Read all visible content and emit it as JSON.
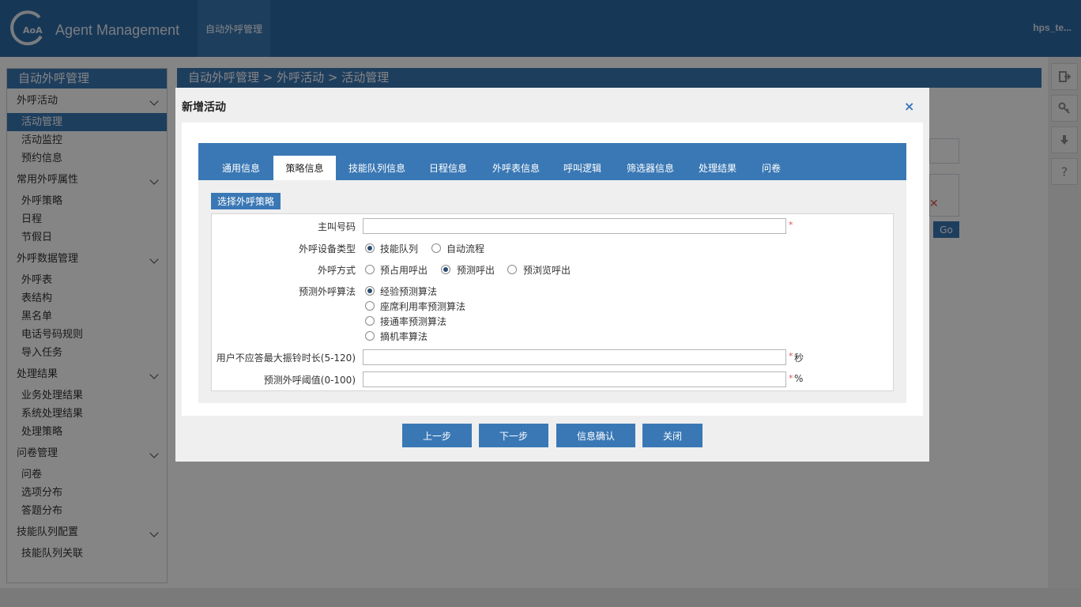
{
  "header": {
    "brand": "Agent Management",
    "nav_tab": "自动外呼管理",
    "user": "hps_te..."
  },
  "tools": [
    "logout-icon",
    "key-icon",
    "download-icon",
    "help-icon"
  ],
  "sidebar": {
    "title": "自动外呼管理",
    "groups": [
      {
        "label": "外呼活动",
        "items": [
          "活动管理",
          "活动监控",
          "预约信息"
        ]
      },
      {
        "label": "常用外呼属性",
        "items": [
          "外呼策略",
          "日程",
          "节假日"
        ]
      },
      {
        "label": "外呼数据管理",
        "items": [
          "外呼表",
          "表结构",
          "黑名单",
          "电话号码规则",
          "导入任务"
        ]
      },
      {
        "label": "处理结果",
        "items": [
          "业务处理结果",
          "系统处理结果",
          "处理策略"
        ]
      },
      {
        "label": "问卷管理",
        "items": [
          "问卷",
          "选项分布",
          "答题分布"
        ]
      },
      {
        "label": "技能队列配置",
        "items": [
          "技能队列关联"
        ]
      }
    ]
  },
  "breadcrumb": "自动外呼管理 > 外呼活动 > 活动管理",
  "go_label": "Go",
  "dialog": {
    "title": "新增活动",
    "close": "×",
    "tabs": [
      "通用信息",
      "策略信息",
      "技能队列信息",
      "日程信息",
      "外呼表信息",
      "呼叫逻辑",
      "筛选器信息",
      "处理结果",
      "问卷"
    ],
    "active_tab": 1,
    "strategy_button": "选择外呼策略",
    "form": {
      "caller_label": "主叫号码",
      "caller_value": "",
      "device_label": "外呼设备类型",
      "device_options": [
        "技能队列",
        "自动流程"
      ],
      "device_selected": 0,
      "mode_label": "外呼方式",
      "mode_options": [
        "预占用呼出",
        "预测呼出",
        "预浏览呼出"
      ],
      "mode_selected": 1,
      "algo_label": "预测外呼算法",
      "algo_options": [
        "经验预测算法",
        "座席利用率预测算法",
        "接通率预测算法",
        "摘机率算法"
      ],
      "algo_selected": 0,
      "ring_label": "用户不应答最大振铃时长(5-120)",
      "ring_value": "",
      "ring_unit": "秒",
      "threshold_label": "预测外呼阈值(0-100)",
      "threshold_value": "",
      "threshold_unit": "%",
      "required_mark": "*"
    },
    "buttons": {
      "prev": "上一步",
      "next": "下一步",
      "confirm": "信息确认",
      "close": "关闭"
    }
  },
  "colors": {
    "primary": "#3a78b5",
    "required": "#d9534f"
  }
}
